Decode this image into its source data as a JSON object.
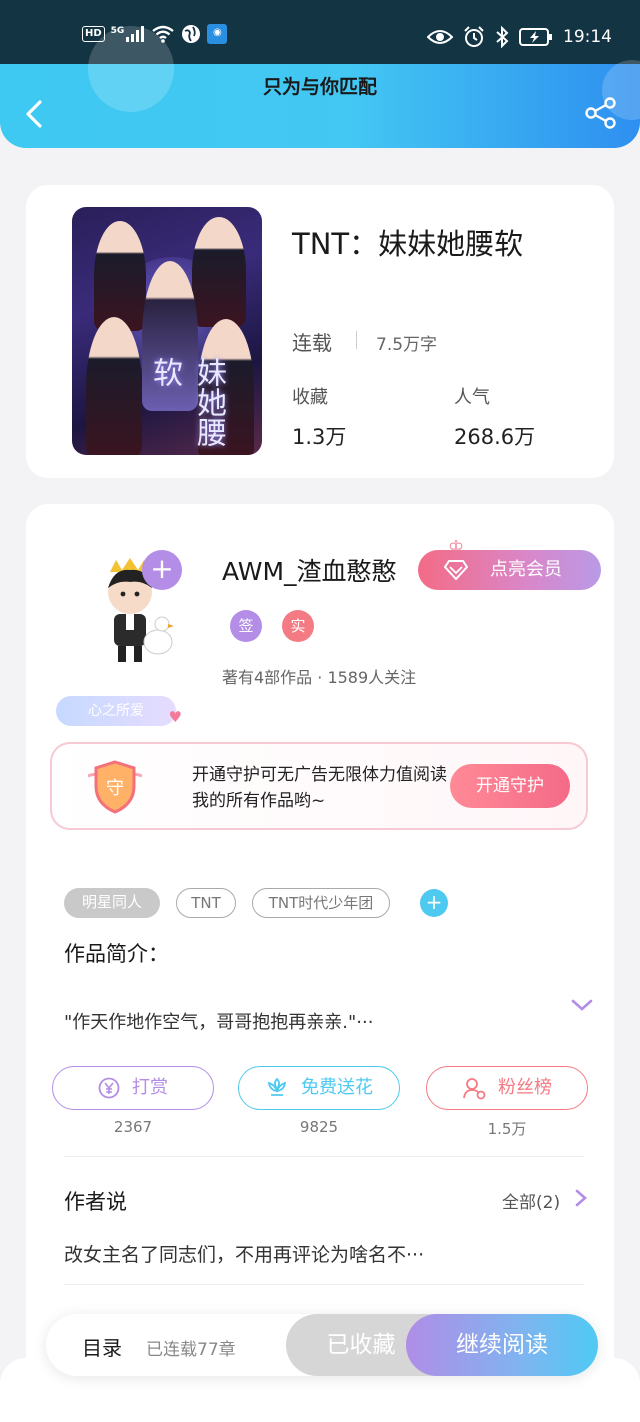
{
  "status_bar": {
    "left_labels": [
      "HD",
      "5G"
    ],
    "time": "19:14",
    "icons": [
      "hd-icon",
      "signal-5g-icon",
      "wifi-icon",
      "globe-icon",
      "app-notify-icon",
      "eye-icon",
      "alarm-icon",
      "bluetooth-icon",
      "battery-icon"
    ]
  },
  "header": {
    "title": "只为与你匹配",
    "back_icon": "chevron-left-icon",
    "share_icon": "share-icon"
  },
  "book": {
    "title": "TNT：妹妹她腰软",
    "cover_text": "妹她腰软",
    "status": "连载",
    "word_count": "7.5万字",
    "favorites_label": "收藏",
    "favorites_value": "1.3万",
    "popularity_label": "人气",
    "popularity_value": "268.6万"
  },
  "author": {
    "name": "AWM_渣血憨憨",
    "member_button": "点亮会员",
    "badge_sign": "签",
    "badge_real": "实",
    "meta": "著有4部作品 · 1589人关注",
    "heart_tag": "心之所爱",
    "colors": {
      "sign_badge": "#b38de6",
      "real_badge": "#f47a83"
    }
  },
  "guard": {
    "shield_text": "守",
    "text": "开通守护可无广告无限体力值阅读我的所有作品哟~",
    "button": "开通守护"
  },
  "tags": {
    "items": [
      "明星同人",
      "TNT",
      "TNT时代少年团"
    ],
    "add_icon": "plus-icon"
  },
  "intro": {
    "title": "作品简介：",
    "text": "\"作天作地作空气，哥哥抱抱再亲亲.\"···"
  },
  "actions": {
    "reward_label": "打赏",
    "reward_count": "2367",
    "flower_label": "免费送花",
    "flower_count": "9825",
    "fans_label": "粉丝榜",
    "fans_count": "1.5万",
    "colors": {
      "reward": "#b38de6",
      "flower": "#4ec9f0",
      "fans": "#f47a83"
    }
  },
  "author_says": {
    "title": "作者说",
    "all_label": "全部(2)",
    "text": "改女主名了同志们，不用再评论为啥名不···"
  },
  "bottom_bar": {
    "toc_label": "目录",
    "toc_count": "已连载77章",
    "collected_label": "已收藏",
    "continue_label": "继续阅读"
  }
}
